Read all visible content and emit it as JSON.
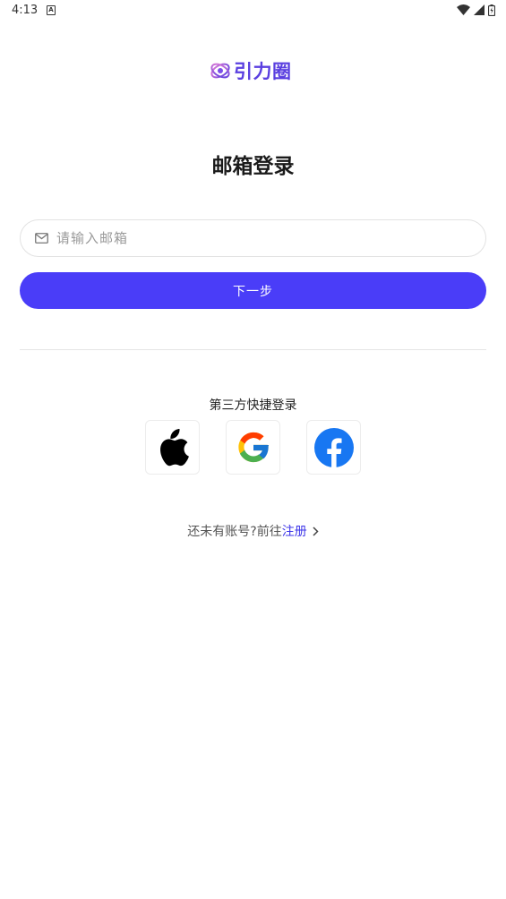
{
  "status_bar": {
    "time": "4:13",
    "notification_letter": "A"
  },
  "logo": {
    "text": "引力圈",
    "color": "#5a3fe0"
  },
  "page": {
    "title": "邮箱登录"
  },
  "email": {
    "placeholder": "请输入邮箱",
    "value": ""
  },
  "next_button": {
    "label": "下一步",
    "color": "#4a3df8"
  },
  "third_party": {
    "title": "第三方快捷登录",
    "providers": [
      "apple",
      "google",
      "facebook"
    ]
  },
  "register": {
    "prompt": "还未有账号?前往",
    "link_label": "注册"
  }
}
